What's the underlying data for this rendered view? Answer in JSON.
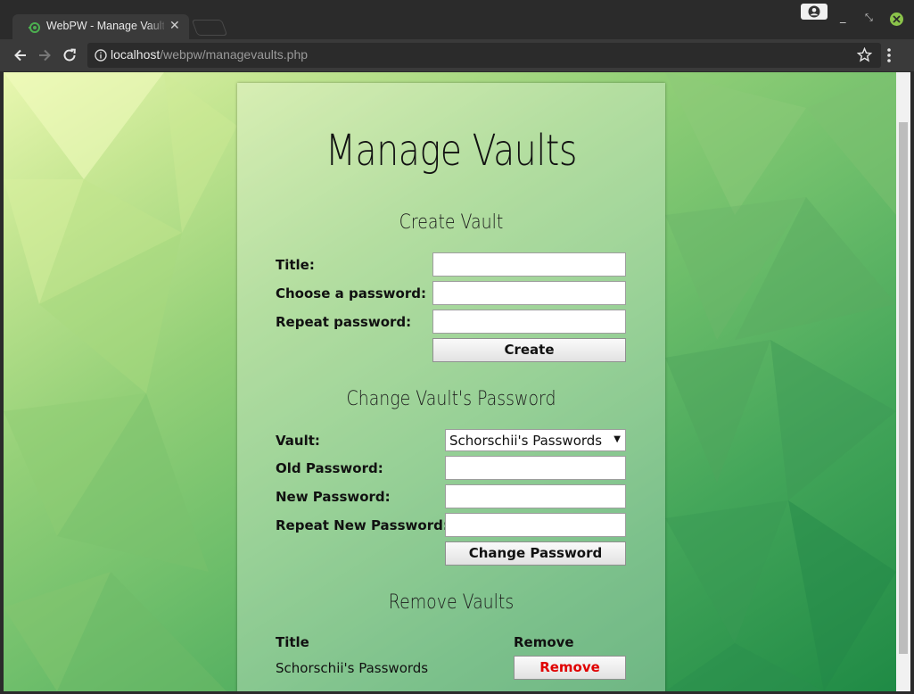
{
  "browser": {
    "tab_title": "WebPW - Manage Vaults",
    "url_host": "localhost",
    "url_path": "/webpw/managevaults.php",
    "icons": [
      "tab-favicon-icon",
      "close-tab-icon",
      "back-icon",
      "forward-icon",
      "reload-icon",
      "info-icon",
      "star-icon",
      "menu-icon",
      "profile-icon",
      "minimize-icon",
      "restore-icon",
      "close-window-icon"
    ],
    "accent": "#8bc34a"
  },
  "page": {
    "title": "Manage Vaults",
    "create": {
      "heading": "Create Vault",
      "title_label": "Title:",
      "password_label": "Choose a password:",
      "repeat_label": "Repeat password:",
      "title_value": "",
      "password_value": "",
      "repeat_value": "",
      "button_label": "Create"
    },
    "change": {
      "heading": "Change Vault's Password",
      "vault_label": "Vault:",
      "vault_selected": "Schorschii's Passwords",
      "old_label": "Old Password:",
      "new_label": "New Password:",
      "repeat_label": "Repeat New Password:",
      "old_value": "",
      "new_value": "",
      "repeat_value": "",
      "button_label": "Change Password"
    },
    "remove": {
      "heading": "Remove Vaults",
      "columns": [
        "Title",
        "Remove"
      ],
      "rows": [
        {
          "title": "Schorschii's Passwords",
          "button_label": "Remove"
        }
      ],
      "button_color": "#e00000"
    }
  }
}
